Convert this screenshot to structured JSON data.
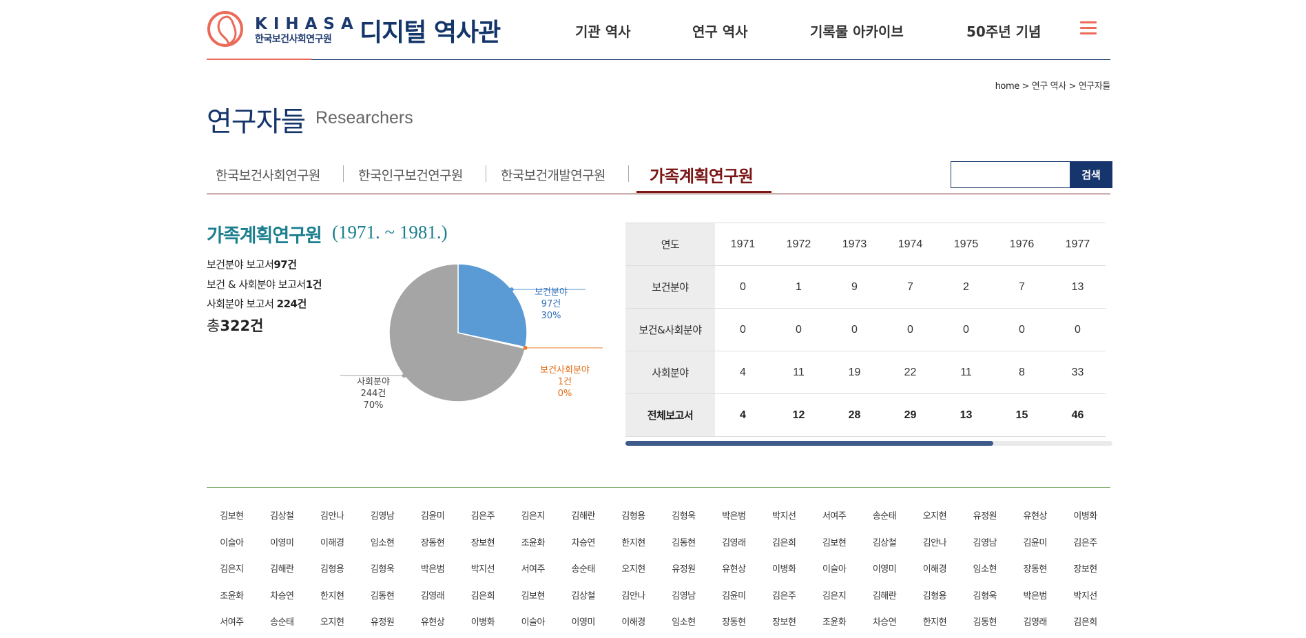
{
  "header": {
    "logo_en": "KIHASA",
    "logo_ko": "한국보건사회연구원",
    "site_title": "디지털 역사관",
    "nav": [
      {
        "label": "기관 역사"
      },
      {
        "label": "연구 역사"
      },
      {
        "label": "기록물 아카이브"
      },
      {
        "label": "50주년 기념"
      }
    ],
    "menu_icon": "hamburger-icon",
    "accent_color": "#ec6a59",
    "brand_color": "#14356a"
  },
  "breadcrumb": {
    "home": "home",
    "sep": " > ",
    "level1": "연구 역사",
    "level2": "연구자들"
  },
  "page": {
    "title": "연구자들",
    "title_en": "Researchers"
  },
  "tabs": [
    {
      "label": "한국보건사회연구원",
      "active": false
    },
    {
      "label": "한국인구보건연구원",
      "active": false
    },
    {
      "label": "한국보건개발연구원",
      "active": false
    },
    {
      "label": "가족계획연구원",
      "active": true
    }
  ],
  "search": {
    "placeholder": "",
    "button": "검색"
  },
  "summary": {
    "title": "가족계획연구원",
    "period": "(1971. ~ 1981.)",
    "stats": [
      {
        "label": "보건분야 보고서",
        "value": "97건"
      },
      {
        "label": "보건 & 사회분야 보고서",
        "value": "1건"
      },
      {
        "label": "사회분야 보고서 ",
        "value": "224건"
      }
    ],
    "total_label": "총",
    "total_value": "322건"
  },
  "chart_data": {
    "type": "pie",
    "slices": [
      {
        "name": "보건분야",
        "count_label": "97건",
        "percent_label": "30%",
        "value": 97,
        "color": "#5b9bd5",
        "label_color": "#2f6fb5"
      },
      {
        "name": "보건사회분야",
        "count_label": "1건",
        "percent_label": "0%",
        "value": 1,
        "color": "#ed7d31",
        "label_color": "#e06a10"
      },
      {
        "name": "사회분야",
        "count_label": "244건",
        "percent_label": "70%",
        "value": 244,
        "color": "#a5a5a5",
        "label_color": "#444444"
      }
    ]
  },
  "table": {
    "header_label": "연도",
    "years": [
      "1971",
      "1972",
      "1973",
      "1974",
      "1975",
      "1976",
      "1977"
    ],
    "rows": [
      {
        "label": "보건분야",
        "values": [
          "0",
          "1",
          "9",
          "7",
          "2",
          "7",
          "13"
        ]
      },
      {
        "label": "보건&사회분야",
        "values": [
          "0",
          "0",
          "0",
          "0",
          "0",
          "0",
          "0"
        ]
      },
      {
        "label": "사회분야",
        "values": [
          "4",
          "11",
          "19",
          "22",
          "11",
          "8",
          "33"
        ]
      },
      {
        "label": "전체보고서",
        "values": [
          "4",
          "12",
          "28",
          "29",
          "13",
          "15",
          "46"
        ]
      }
    ],
    "scroll_fraction": 0.755
  },
  "researchers": [
    "김보현",
    "김상철",
    "김안나",
    "김영남",
    "김윤미",
    "김은주",
    "김은지",
    "김해란",
    "김형용",
    "김형욱",
    "박은범",
    "박지선",
    "서여주",
    "송순태",
    "오지현",
    "유정원",
    "유현상",
    "이병화",
    "이슬아",
    "이영미",
    "이해경",
    "임소현",
    "장동현",
    "장보현",
    "조윤화",
    "차승연",
    "한지현",
    "김동현",
    "김영래",
    "김은희",
    "김보현",
    "김상철",
    "김안나",
    "김영남",
    "김윤미",
    "김은주",
    "김은지",
    "김해란",
    "김형용",
    "김형욱",
    "박은범",
    "박지선",
    "서여주",
    "송순태",
    "오지현",
    "유정원",
    "유현상",
    "이병화",
    "이슬아",
    "이영미",
    "이해경",
    "임소현",
    "장동현",
    "장보현",
    "조윤화",
    "차승연",
    "한지현",
    "김동현",
    "김영래",
    "김은희",
    "김보현",
    "김상철",
    "김안나",
    "김영남",
    "김윤미",
    "김은주",
    "김은지",
    "김해란",
    "김형용",
    "김형욱",
    "박은범",
    "박지선",
    "서여주",
    "송순태",
    "오지현",
    "유정원",
    "유현상",
    "이병화",
    "이슬아",
    "이영미",
    "이해경",
    "임소현",
    "장동현",
    "장보현",
    "조윤화",
    "차승연",
    "한지현",
    "김동현",
    "김영래",
    "김은희"
  ]
}
